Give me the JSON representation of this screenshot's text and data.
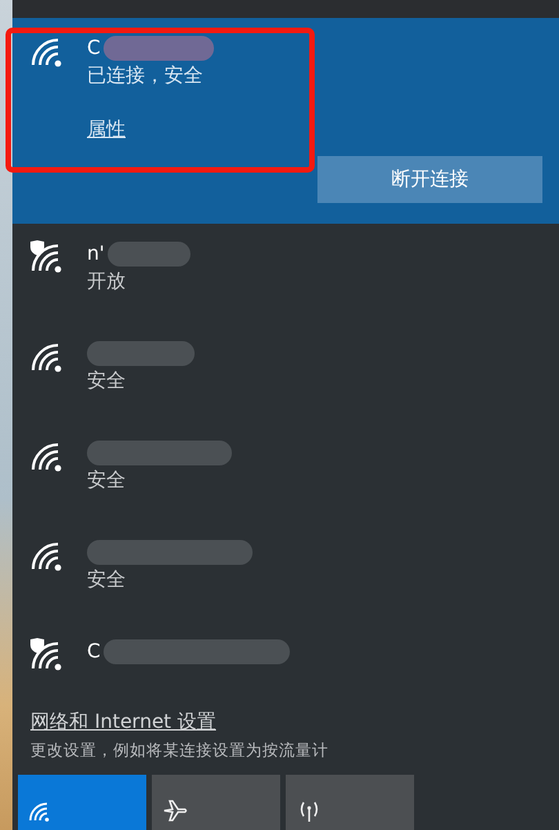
{
  "connected": {
    "name": "C",
    "status": "已连接，安全",
    "link": "属性",
    "button": "断开连接"
  },
  "networks": [
    {
      "name": "n'",
      "status": "开放",
      "warning": true
    },
    {
      "status": "安全",
      "warning": false
    },
    {
      "status": "安全",
      "warning": false
    },
    {
      "status": "安全",
      "warning": false
    },
    {
      "name": "C",
      "warning": true
    }
  ],
  "settings": {
    "title": "网络和 Internet 设置",
    "description": "更改设置，例如将某连接设置为按流量计"
  },
  "quick_actions": [
    {
      "kind": "wifi",
      "selected": true
    },
    {
      "kind": "airplane",
      "selected": false
    },
    {
      "kind": "hotspot",
      "selected": false
    }
  ]
}
